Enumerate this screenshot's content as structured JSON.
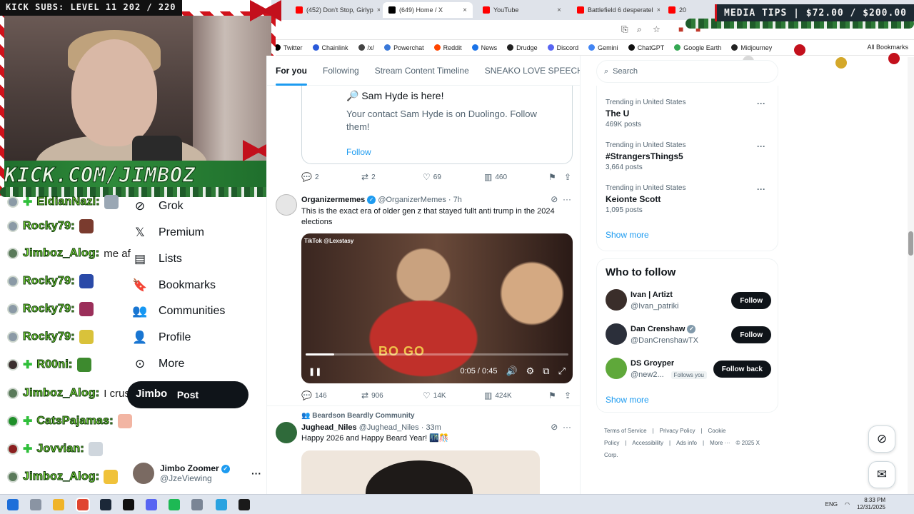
{
  "overlay": {
    "kick_subs": "KICK SUBS: LEVEL 11 202 / 220",
    "media_tips": "MEDIA TIPS | $72.00 / $200.00",
    "kick_url": "KICK.COM/JIMBOZ"
  },
  "browser": {
    "tabs": [
      {
        "label": "(452) Don't Stop, Girlyp",
        "favicon_color": "#ff0000",
        "active": false
      },
      {
        "label": "(649) Home / X",
        "favicon_color": "#000000",
        "active": true
      },
      {
        "label": "YouTube",
        "favicon_color": "#ff0000",
        "active": false
      },
      {
        "label": "Battlefield 6 desperatel",
        "favicon_color": "#ff0000",
        "active": false
      },
      {
        "label": "20",
        "favicon_color": "#ff0000",
        "active": false
      }
    ],
    "bookmarks": [
      {
        "label": "Twitter",
        "color": "#000000"
      },
      {
        "label": "Chainlink",
        "color": "#2a5ada"
      },
      {
        "label": "/x/",
        "color": "#444444"
      },
      {
        "label": "Powerchat",
        "color": "#3a78d8"
      },
      {
        "label": "Reddit",
        "color": "#ff4500"
      },
      {
        "label": "News",
        "color": "#1a73e8"
      },
      {
        "label": "Drudge",
        "color": "#222222"
      },
      {
        "label": "Discord",
        "color": "#5865f2"
      },
      {
        "label": "Gemini",
        "color": "#4285f4"
      },
      {
        "label": "ChatGPT",
        "color": "#111111"
      },
      {
        "label": "Google Earth",
        "color": "#34a853"
      },
      {
        "label": "Midjourney",
        "color": "#222222"
      }
    ],
    "all_bookmarks": "All Bookmarks"
  },
  "chat": [
    {
      "name": "EldianNazi:",
      "message": "",
      "emote": "#9aa7b4",
      "badge": "gray",
      "cross": true
    },
    {
      "name": "Rocky79:",
      "message": "",
      "emote": "#7a3b2e",
      "badge": "gray",
      "cross": false
    },
    {
      "name": "Jimboz_Alog:",
      "message": "me af",
      "emote": "",
      "badge": "green",
      "cross": false
    },
    {
      "name": "Rocky79:",
      "message": "",
      "emote": "#2a4aa8",
      "badge": "gray",
      "cross": false
    },
    {
      "name": "Rocky79:",
      "message": "",
      "emote": "#9b2f5a",
      "badge": "gray",
      "cross": false
    },
    {
      "name": "Rocky79:",
      "message": "",
      "emote": "#d9c23a",
      "badge": "gray",
      "cross": false
    },
    {
      "name": "R00ni:",
      "message": "",
      "emote": "#3d8a2e",
      "badge": "dark",
      "cross": true
    },
    {
      "name": "Jimboz_Alog:",
      "message": "I crush",
      "emote": "",
      "badge": "green",
      "cross": false
    },
    {
      "name": "CatsPajamas:",
      "message": "",
      "emote": "#f2b5a3",
      "badge": "k",
      "cross": true
    },
    {
      "name": "Jovvian:",
      "message": "",
      "emote": "#cfd6dd",
      "badge": "red",
      "cross": true
    },
    {
      "name": "Jimboz_Alog:",
      "message": "",
      "emote": "#f0c23a",
      "badge": "green",
      "cross": false
    }
  ],
  "nav": {
    "items": [
      {
        "label": "Grok",
        "icon": "grok-icon",
        "glyph": "⊘"
      },
      {
        "label": "Premium",
        "icon": "x-logo-icon",
        "glyph": "𝕏"
      },
      {
        "label": "Lists",
        "icon": "list-icon",
        "glyph": "▤"
      },
      {
        "label": "Bookmarks",
        "icon": "bookmark-icon",
        "glyph": "🔖"
      },
      {
        "label": "Communities",
        "icon": "communities-icon",
        "glyph": "👥"
      },
      {
        "label": "Profile",
        "icon": "profile-icon",
        "glyph": "👤"
      },
      {
        "label": "More",
        "icon": "more-circle-icon",
        "glyph": "⊙"
      }
    ],
    "post_button": "Post",
    "post_overlay_text": "Jimbo",
    "account": {
      "name": "Jimbo Zoomer",
      "handle": "@JzeViewing"
    }
  },
  "feed": {
    "tabs": [
      "For you",
      "Following",
      "Stream Content Timeline",
      "SNEAKO LOVE SPEECH"
    ],
    "card": {
      "title": "🔎 Sam Hyde is here!",
      "body": "Your contact Sam Hyde is on Duolingo. Follow them!",
      "follow": "Follow"
    },
    "card_actions": {
      "replies": "2",
      "reposts": "2",
      "likes": "69",
      "views": "460"
    },
    "post1": {
      "name": "Organizermemes",
      "handle": "@OrganizerMemes",
      "time": "· 7h",
      "text": "This is the exact era of older gen z that stayed fullt anti trump in the 2024 elections",
      "video": {
        "watermark": "TikTok @Lexstasy",
        "time": "0:05 / 0:45",
        "progress": 0.11,
        "shirt_text": "BO GO"
      },
      "actions": {
        "replies": "146",
        "reposts": "906",
        "likes": "14K",
        "views": "424K"
      }
    },
    "post2": {
      "community": "Beardson Beardly Community",
      "name": "Jughead_Niles",
      "handle": "@Jughead_Niles",
      "time": "· 33m",
      "text": "Happy 2026 and Happy Beard Year! 🌃🎊"
    }
  },
  "sidebar": {
    "search_placeholder": "Search",
    "trends": [
      {
        "context": "Trending in United States",
        "topic": "The U",
        "posts": "469K posts"
      },
      {
        "context": "Trending in United States",
        "topic": "#StrangersThings5",
        "posts": "3,664 posts"
      },
      {
        "context": "Trending in United States",
        "topic": "Keionte Scott",
        "posts": "1,095 posts"
      }
    ],
    "show_more": "Show more",
    "who_to_follow": {
      "title": "Who to follow",
      "accounts": [
        {
          "name": "Ivan | Artizt",
          "handle": "@Ivan_patriki",
          "button": "Follow",
          "verified": false,
          "follows_you": "",
          "avatar": "#3a2e2a"
        },
        {
          "name": "Dan Crenshaw",
          "handle": "@DanCrenshawTX",
          "button": "Follow",
          "verified": true,
          "follows_you": "",
          "avatar": "#2b2f3a"
        },
        {
          "name": "DS Groyper",
          "handle": "@new2...",
          "button": "Follow back",
          "verified": false,
          "follows_you": "Follows you",
          "avatar": "#5fa83a"
        }
      ],
      "show_more": "Show more"
    },
    "footer": [
      "Terms of Service",
      "|",
      "Privacy Policy",
      "|",
      "Cookie Policy",
      "|",
      "Accessibility",
      "|",
      "Ads info",
      "|",
      "More ···",
      "© 2025 X Corp."
    ]
  },
  "taskbar": {
    "lang": "ENG",
    "time": "8:33 PM",
    "date": "12/31/2025"
  }
}
